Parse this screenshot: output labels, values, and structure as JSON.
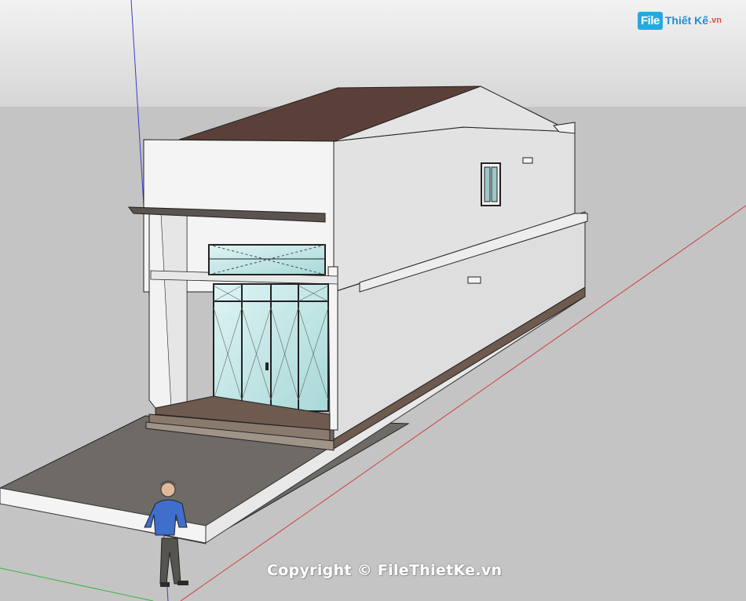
{
  "logo": {
    "badge": "File",
    "word": "Thiết Kế",
    "tld": ".vn"
  },
  "watermark": {
    "text": "Copyright © FileThietKe.vn"
  },
  "colors": {
    "sky": "#dcdcdc",
    "ground": "#c0c0c0",
    "roof": "#5a4038",
    "wall_front": "#f4f4f4",
    "wall_side": "#dedede",
    "paving": "#6e6a66",
    "red_axis": "#d33c3c",
    "blue_axis": "#3c3cc8",
    "green_axis": "#3cb43c"
  }
}
